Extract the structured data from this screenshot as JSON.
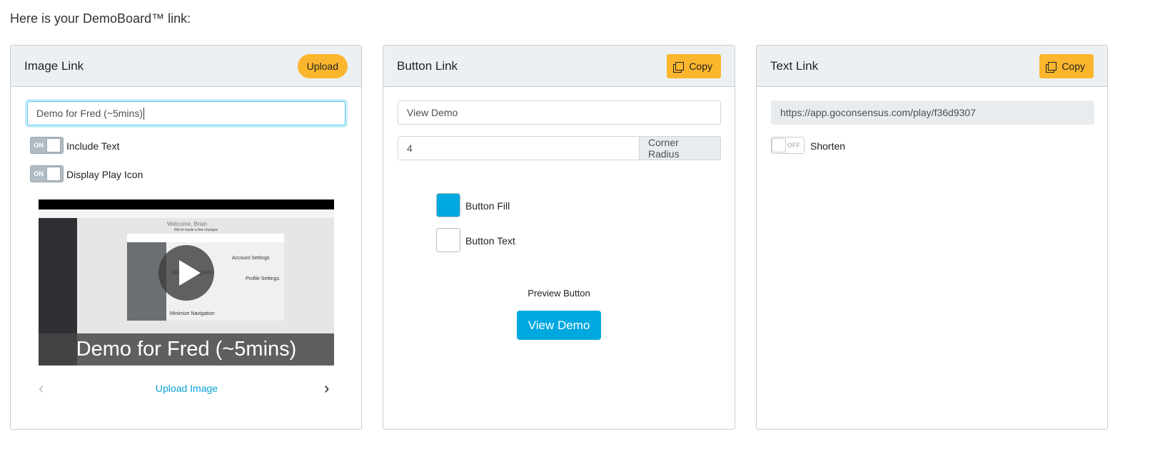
{
  "intro": "Here is your DemoBoard™ link:",
  "image_card": {
    "title": "Image Link",
    "upload_label": "Upload",
    "title_input": "Demo for Fred (~5mins)",
    "toggles": [
      {
        "label": "Include Text",
        "state": "ON"
      },
      {
        "label": "Display Play Icon",
        "state": "ON"
      }
    ],
    "thumbnail": {
      "caption": "Demo for Fred (~5mins)",
      "welcome": "Welcome, Brian",
      "subtitle": "We've made a few changes",
      "callouts": [
        "Account Settings",
        "Profile Settings",
        "Minimize Navigation",
        "Ma",
        "gation"
      ]
    },
    "upload_image_link": "Upload Image"
  },
  "button_card": {
    "title": "Button Link",
    "copy_label": "Copy",
    "button_text_value": "View Demo",
    "corner_radius_value": "4",
    "corner_radius_label": "Corner Radius",
    "fill_label": "Button Fill",
    "fill_color": "#00a8e0",
    "text_label": "Button Text",
    "text_color": "#ffffff",
    "preview_label": "Preview Button",
    "preview_button": "View Demo"
  },
  "text_card": {
    "title": "Text Link",
    "copy_label": "Copy",
    "url": "https://app.goconsensus.com/play/f36d9307",
    "shorten_label": "Shorten",
    "shorten_state": "OFF"
  }
}
